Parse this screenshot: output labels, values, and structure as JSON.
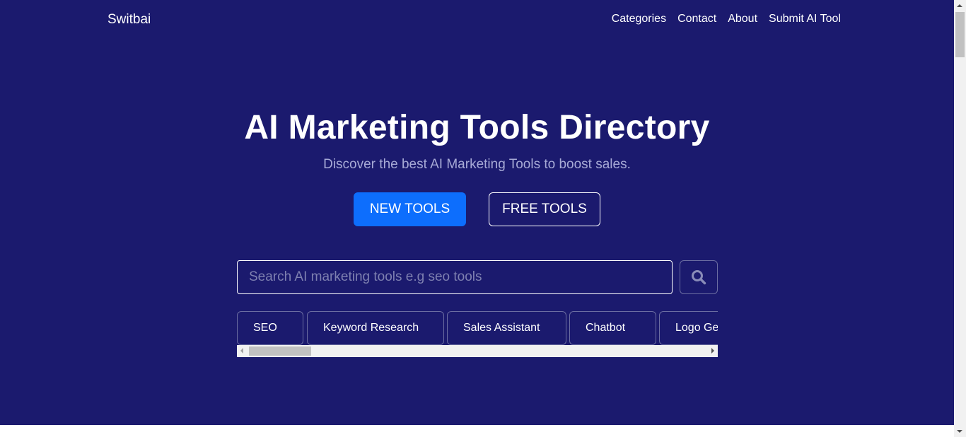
{
  "brand": {
    "name": "Switbai"
  },
  "nav": {
    "items": [
      {
        "label": "Categories"
      },
      {
        "label": "Contact"
      },
      {
        "label": "About"
      },
      {
        "label": "Submit AI Tool"
      }
    ]
  },
  "hero": {
    "title": "AI Marketing Tools Directory",
    "subtitle": "Discover the best AI Marketing Tools to boost sales.",
    "buttons": {
      "new_tools": "NEW TOOLS",
      "free_tools": "FREE TOOLS"
    }
  },
  "search": {
    "placeholder": "Search AI marketing tools e.g seo tools",
    "icon": "search-icon"
  },
  "categories": [
    {
      "label": "SEO"
    },
    {
      "label": "Keyword Research"
    },
    {
      "label": "Sales Assistant"
    },
    {
      "label": "Chatbot"
    },
    {
      "label": "Logo Ge"
    }
  ],
  "colors": {
    "background": "#1b1a6e",
    "primary": "#0d6efd",
    "text": "#ffffff",
    "muted": "#a7aad6"
  }
}
